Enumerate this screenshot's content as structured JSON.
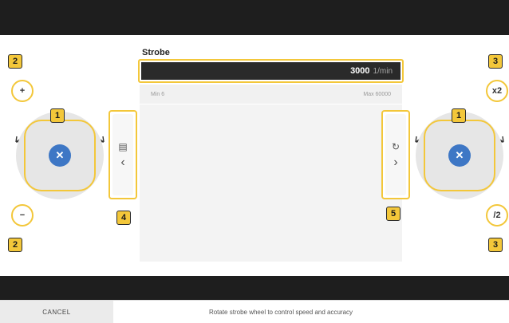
{
  "panel": {
    "title": "Strobe",
    "speed_value": "3000",
    "speed_unit": "1/min",
    "min_label": "Min 6",
    "max_label": "Max 60000"
  },
  "left_controls": {
    "plus_label": "+",
    "minus_label": "−",
    "wheel_icon": "close-x-icon",
    "wheel_glyph": "✕"
  },
  "right_controls": {
    "multiply_label": "x2",
    "divide_label": "/2",
    "wheel_icon": "close-x-icon",
    "wheel_glyph": "✕"
  },
  "side_buttons": {
    "left_top_glyph": "▤",
    "left_bottom_glyph": "‹",
    "right_top_glyph": "↻",
    "right_bottom_glyph": "›"
  },
  "badges": {
    "wheel_left": "1",
    "wheel_right": "1",
    "plus": "2",
    "minus": "2",
    "x2": "3",
    "div2": "3",
    "prev": "4",
    "next": "5"
  },
  "footer": {
    "cancel_label": "CANCEL",
    "hint": "Rotate strobe wheel to control speed and accuracy"
  },
  "colors": {
    "accent_yellow": "#f3c73a",
    "wheel_blue": "#3e77c5",
    "dark_bar": "#1e1e1e"
  }
}
